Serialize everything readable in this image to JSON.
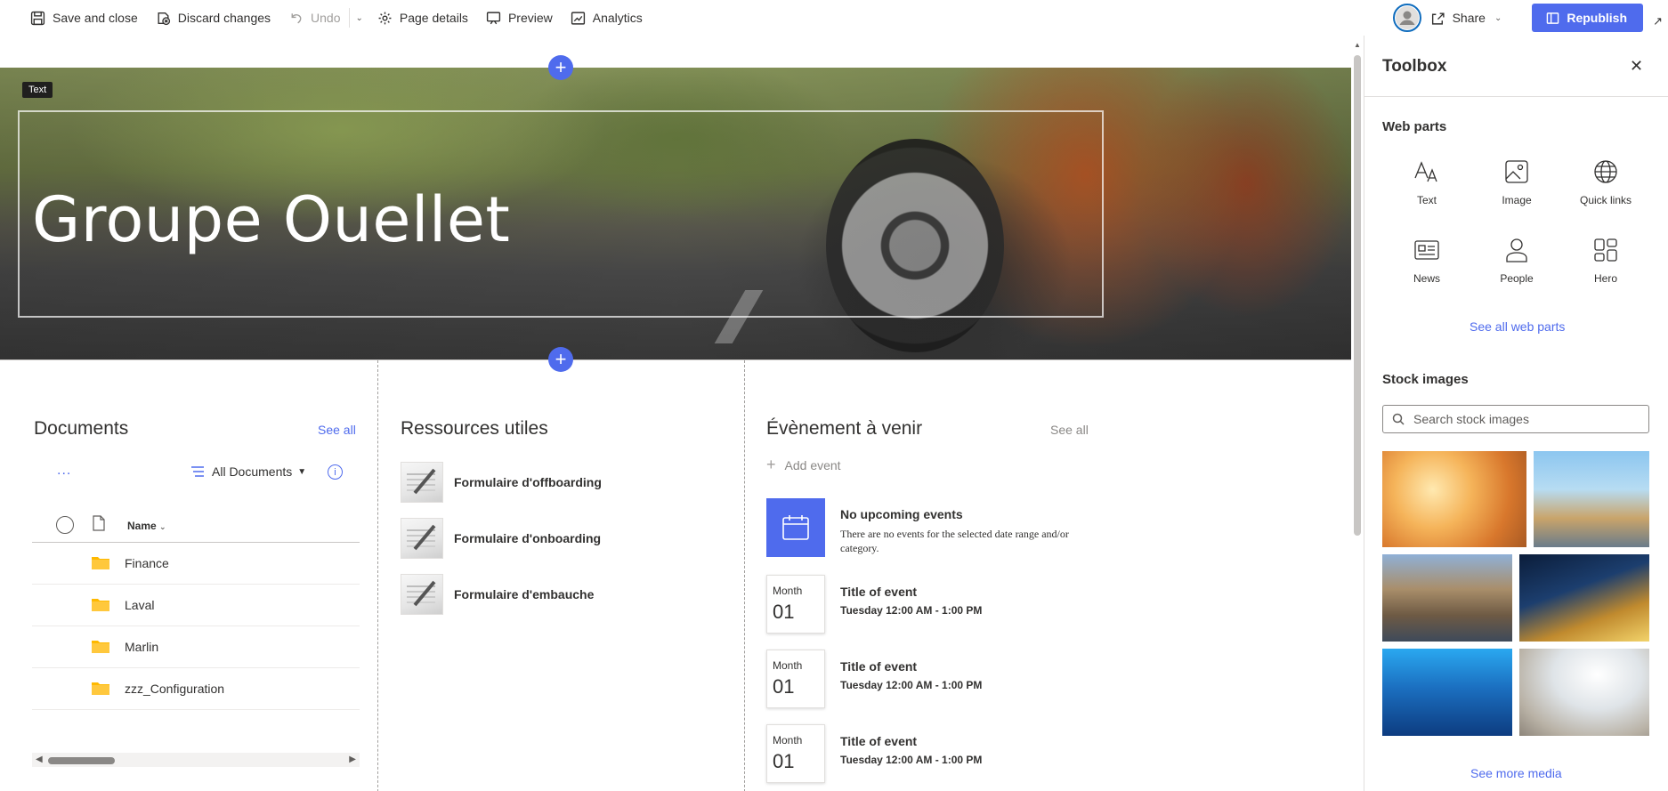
{
  "toolbar": {
    "save_close": "Save and close",
    "discard": "Discard changes",
    "undo": "Undo",
    "page_details": "Page details",
    "preview": "Preview",
    "analytics": "Analytics",
    "share": "Share",
    "republish": "Republish"
  },
  "hero": {
    "label": "Text",
    "title": "Groupe Ouellet"
  },
  "documents": {
    "title": "Documents",
    "see_all": "See all",
    "more": "...",
    "view": "All Documents",
    "info": "i",
    "column_name": "Name",
    "rows": [
      {
        "name": "Finance"
      },
      {
        "name": "Laval"
      },
      {
        "name": "Marlin"
      },
      {
        "name": "zzz_Configuration"
      }
    ]
  },
  "resources": {
    "title": "Ressources utiles",
    "items": [
      {
        "label": "Formulaire d'offboarding"
      },
      {
        "label": "Formulaire d'onboarding"
      },
      {
        "label": "Formulaire d'embauche"
      }
    ]
  },
  "events": {
    "title": "Évènement à venir",
    "see_all": "See all",
    "add_event": "Add event",
    "no_events_title": "No upcoming events",
    "no_events_desc": "There are no events for the selected date range and/or category.",
    "items": [
      {
        "month": "Month",
        "day": "01",
        "title": "Title of event",
        "time": "Tuesday 12:00 AM - 1:00 PM"
      },
      {
        "month": "Month",
        "day": "01",
        "title": "Title of event",
        "time": "Tuesday 12:00 AM - 1:00 PM"
      },
      {
        "month": "Month",
        "day": "01",
        "title": "Title of event",
        "time": "Tuesday 12:00 AM - 1:00 PM"
      }
    ]
  },
  "toolbox": {
    "title": "Toolbox",
    "web_parts_heading": "Web parts",
    "web_parts": [
      {
        "label": "Text",
        "icon": "text-icon"
      },
      {
        "label": "Image",
        "icon": "image-icon"
      },
      {
        "label": "Quick links",
        "icon": "globe-icon"
      },
      {
        "label": "News",
        "icon": "news-icon"
      },
      {
        "label": "People",
        "icon": "person-icon"
      },
      {
        "label": "Hero",
        "icon": "hero-grid-icon"
      }
    ],
    "see_all_web_parts": "See all web parts",
    "stock_heading": "Stock images",
    "search_placeholder": "Search stock images",
    "see_more_media": "See more media"
  },
  "colors": {
    "accent": "#4f6bed",
    "text": "#323130"
  }
}
